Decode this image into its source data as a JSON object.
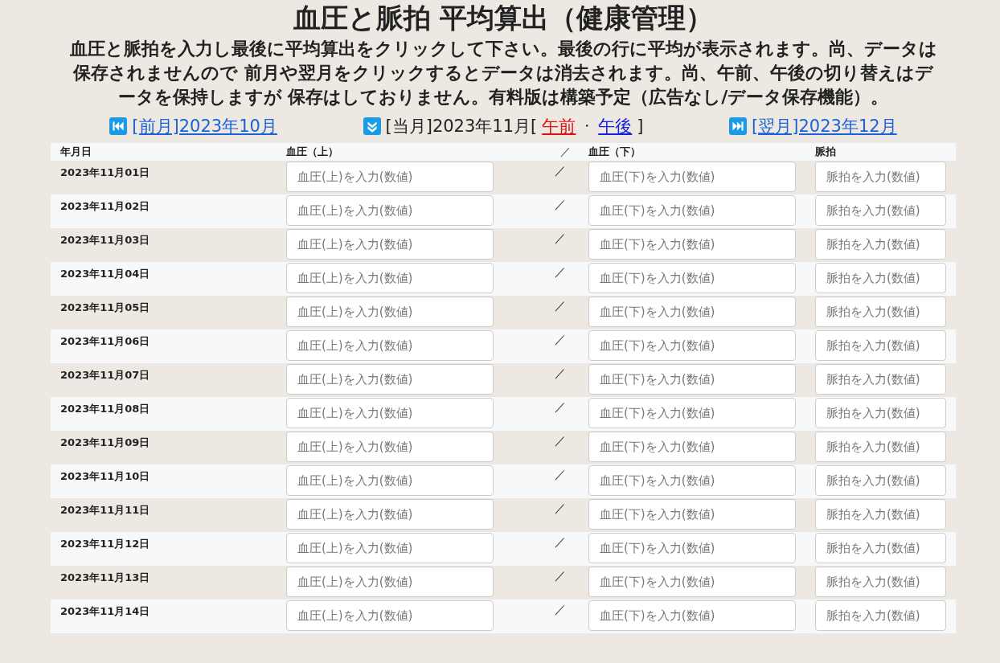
{
  "title": "血圧と脈拍 平均算出（健康管理）",
  "description": "血圧と脈拍を入力し最後に平均算出をクリックして下さい。最後の行に平均が表示されます。尚、データは保存されませんので 前月や翌月をクリックするとデータは消去されます。尚、午前、午後の切り替えはデータを保持しますが 保存はしておりません。有料版は構築予定（広告なし/データ保存機能）。",
  "nav": {
    "prev": {
      "label": "[前月]2023年10月"
    },
    "current": {
      "label": "[当月]2023年11月[",
      "periods": [
        {
          "label": "午前",
          "selected": true
        },
        {
          "label": "午後",
          "selected": false
        }
      ],
      "separator": "・",
      "suffix": "]"
    },
    "next": {
      "label": "[翌月]2023年12月"
    }
  },
  "table": {
    "columns": [
      "年月日",
      "血圧（上）",
      "／",
      "血圧（下）",
      "脈拍"
    ],
    "rows": [
      {
        "date": "2023年11月01日",
        "systolic_placeholder": "血圧(上)を入力(数値)",
        "separator": "／",
        "diastolic_placeholder": "血圧(下)を入力(数値)",
        "pulse_placeholder": "脈拍を入力(数値)"
      },
      {
        "date": "2023年11月02日",
        "systolic_placeholder": "血圧(上)を入力(数値)",
        "separator": "／",
        "diastolic_placeholder": "血圧(下)を入力(数値)",
        "pulse_placeholder": "脈拍を入力(数値)"
      },
      {
        "date": "2023年11月03日",
        "systolic_placeholder": "血圧(上)を入力(数値)",
        "separator": "／",
        "diastolic_placeholder": "血圧(下)を入力(数値)",
        "pulse_placeholder": "脈拍を入力(数値)"
      },
      {
        "date": "2023年11月04日",
        "systolic_placeholder": "血圧(上)を入力(数値)",
        "separator": "／",
        "diastolic_placeholder": "血圧(下)を入力(数値)",
        "pulse_placeholder": "脈拍を入力(数値)"
      },
      {
        "date": "2023年11月05日",
        "systolic_placeholder": "血圧(上)を入力(数値)",
        "separator": "／",
        "diastolic_placeholder": "血圧(下)を入力(数値)",
        "pulse_placeholder": "脈拍を入力(数値)"
      },
      {
        "date": "2023年11月06日",
        "systolic_placeholder": "血圧(上)を入力(数値)",
        "separator": "／",
        "diastolic_placeholder": "血圧(下)を入力(数値)",
        "pulse_placeholder": "脈拍を入力(数値)"
      },
      {
        "date": "2023年11月07日",
        "systolic_placeholder": "血圧(上)を入力(数値)",
        "separator": "／",
        "diastolic_placeholder": "血圧(下)を入力(数値)",
        "pulse_placeholder": "脈拍を入力(数値)"
      },
      {
        "date": "2023年11月08日",
        "systolic_placeholder": "血圧(上)を入力(数値)",
        "separator": "／",
        "diastolic_placeholder": "血圧(下)を入力(数値)",
        "pulse_placeholder": "脈拍を入力(数値)"
      },
      {
        "date": "2023年11月09日",
        "systolic_placeholder": "血圧(上)を入力(数値)",
        "separator": "／",
        "diastolic_placeholder": "血圧(下)を入力(数値)",
        "pulse_placeholder": "脈拍を入力(数値)"
      },
      {
        "date": "2023年11月10日",
        "systolic_placeholder": "血圧(上)を入力(数値)",
        "separator": "／",
        "diastolic_placeholder": "血圧(下)を入力(数値)",
        "pulse_placeholder": "脈拍を入力(数値)"
      },
      {
        "date": "2023年11月11日",
        "systolic_placeholder": "血圧(上)を入力(数値)",
        "separator": "／",
        "diastolic_placeholder": "血圧(下)を入力(数値)",
        "pulse_placeholder": "脈拍を入力(数値)"
      },
      {
        "date": "2023年11月12日",
        "systolic_placeholder": "血圧(上)を入力(数値)",
        "separator": "／",
        "diastolic_placeholder": "血圧(下)を入力(数値)",
        "pulse_placeholder": "脈拍を入力(数値)"
      },
      {
        "date": "2023年11月13日",
        "systolic_placeholder": "血圧(上)を入力(数値)",
        "separator": "／",
        "diastolic_placeholder": "血圧(下)を入力(数値)",
        "pulse_placeholder": "脈拍を入力(数値)"
      },
      {
        "date": "2023年11月14日",
        "systolic_placeholder": "血圧(上)を入力(数値)",
        "separator": "／",
        "diastolic_placeholder": "血圧(下)を入力(数値)",
        "pulse_placeholder": "脈拍を入力(数値)"
      }
    ]
  }
}
